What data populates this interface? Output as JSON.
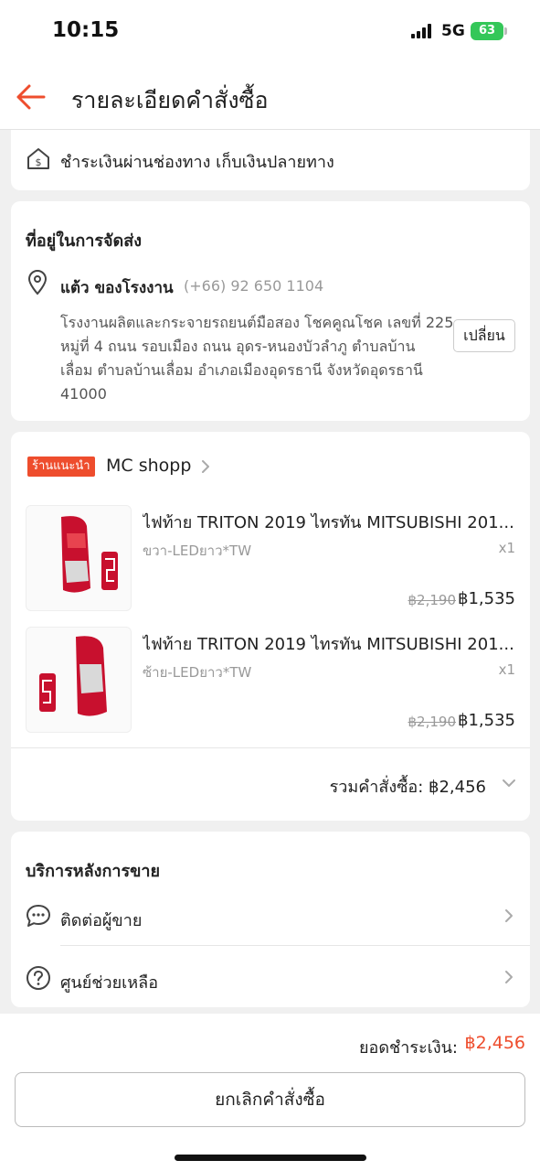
{
  "status_bar": {
    "time": "10:15",
    "network": "5G",
    "battery": "63"
  },
  "header": {
    "title": "รายละเอียดคำสั่งซื้อ"
  },
  "payment": {
    "method": "ชำระเงินผ่านช่องทาง เก็บเงินปลายทาง"
  },
  "address": {
    "section_title": "ที่อยู่ในการจัดส่ง",
    "name": "แต้ว ของโรงงาน",
    "phone": "(+66) 92 650 1104",
    "lines": [
      "โรงงานผลิตและกระจายรถยนต์มือสอง โชคคูณโชค เลขที่ 225",
      "หมู่ที่ 4 ถนน รอบเมือง ถนน อุดร-หนองบัวลำภู ตำบลบ้าน",
      "เลื่อม ตำบลบ้านเลื่อม อำเภอเมืองอุดรธานี จังหวัดอุดรธานี",
      "41000"
    ],
    "change_label": "เปลี่ยน"
  },
  "shop": {
    "badge": "ร้านแนะนำ",
    "name": "MC shopp",
    "products": [
      {
        "name": "ไฟท้าย TRITON 2019 ไทรทัน MITSUBISHI 201...",
        "variant": "ขวา-LEDยาว*TW",
        "qty": "x1",
        "old_price": "฿2,190",
        "price": "฿1,535"
      },
      {
        "name": "ไฟท้าย TRITON 2019 ไทรทัน MITSUBISHI 201...",
        "variant": "ซ้าย-LEDยาว*TW",
        "qty": "x1",
        "old_price": "฿2,190",
        "price": "฿1,535"
      }
    ],
    "order_total": "รวมคำสั่งซื้อ: ฿2,456"
  },
  "after_sales": {
    "title": "บริการหลังการขาย",
    "contact_seller": "ติดต่อผู้ขาย",
    "help_center": "ศูนย์ช่วยเหลือ"
  },
  "bottom": {
    "total_label": "ยอดชำระเงิน:",
    "total_value": "฿2,456",
    "cancel_label": "ยกเลิกคำสั่งซื้อ"
  },
  "colors": {
    "accent": "#ee4d2d",
    "battery": "#34c759"
  }
}
